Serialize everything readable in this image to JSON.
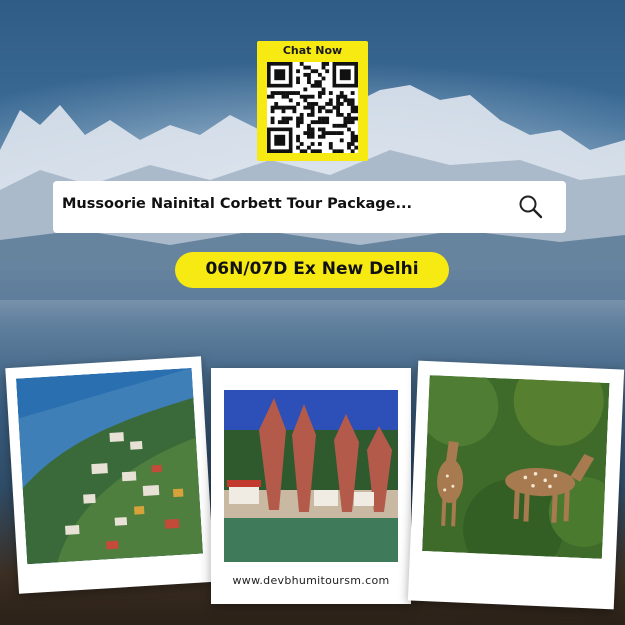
{
  "qr": {
    "label": "Chat Now",
    "icon": "qr-code-icon",
    "background_color": "#f7ea13"
  },
  "search": {
    "text": "Mussoorie Nainital Corbett Tour Package...",
    "icon": "search-icon"
  },
  "duration": {
    "text": "06N/07D Ex New Delhi",
    "background_color": "#f7ea13"
  },
  "photos": [
    {
      "name": "aerial-hill-town-photo"
    },
    {
      "name": "lake-autumn-trees-photo"
    },
    {
      "name": "spotted-deer-photo"
    }
  ],
  "website": "www.devbhumitoursm.com"
}
